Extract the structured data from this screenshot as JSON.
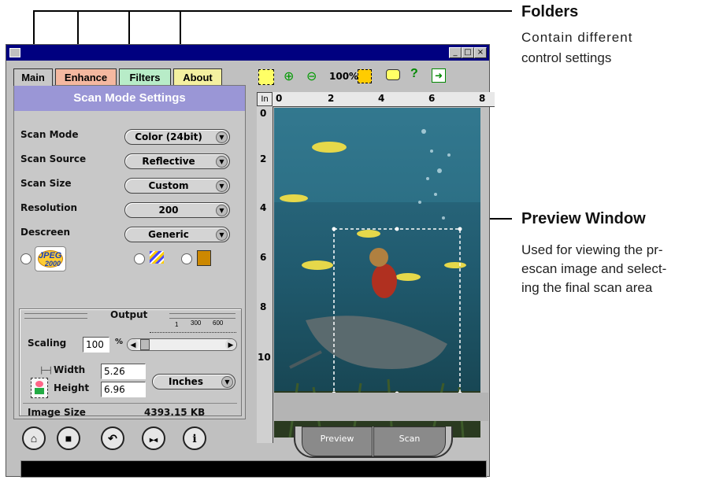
{
  "callouts": {
    "folders_title": "Folders",
    "folders_text": [
      "Contain different",
      "control settings"
    ],
    "preview_title": "Preview Window",
    "preview_text": [
      "Used for viewing the pr-",
      "escan image and select-",
      "ing the final scan area"
    ]
  },
  "tabs": [
    "Main",
    "Enhance",
    "Filters",
    "About"
  ],
  "panel": {
    "header": "Scan Mode Settings",
    "rows": [
      {
        "label": "Scan Mode",
        "value": "Color (24bit)"
      },
      {
        "label": "Scan Source",
        "value": "Reflective"
      },
      {
        "label": "Scan Size",
        "value": "Custom"
      },
      {
        "label": "Resolution",
        "value": "200"
      },
      {
        "label": "Descreen",
        "value": "Generic"
      }
    ],
    "jpeg_label": "JPEG",
    "jpeg_sub": "2000"
  },
  "output": {
    "title": "Output",
    "scaling_label": "Scaling",
    "scaling_value": "100",
    "percent": "%",
    "scale_ticks": [
      "1",
      "300",
      "600"
    ],
    "width_label": "Width",
    "width_value": "5.26",
    "height_label": "Height",
    "height_value": "6.96",
    "units": "Inches",
    "image_size_label": "Image Size",
    "image_size_value": "4393.15 KB"
  },
  "toolbar": {
    "zoom_level": "100%"
  },
  "ruler": {
    "unit": "In",
    "top": [
      "0",
      "2",
      "4",
      "6",
      "8"
    ],
    "left": [
      "0",
      "2",
      "4",
      "6",
      "8",
      "10"
    ]
  },
  "buttons": {
    "preview": "Preview",
    "scan": "Scan"
  }
}
